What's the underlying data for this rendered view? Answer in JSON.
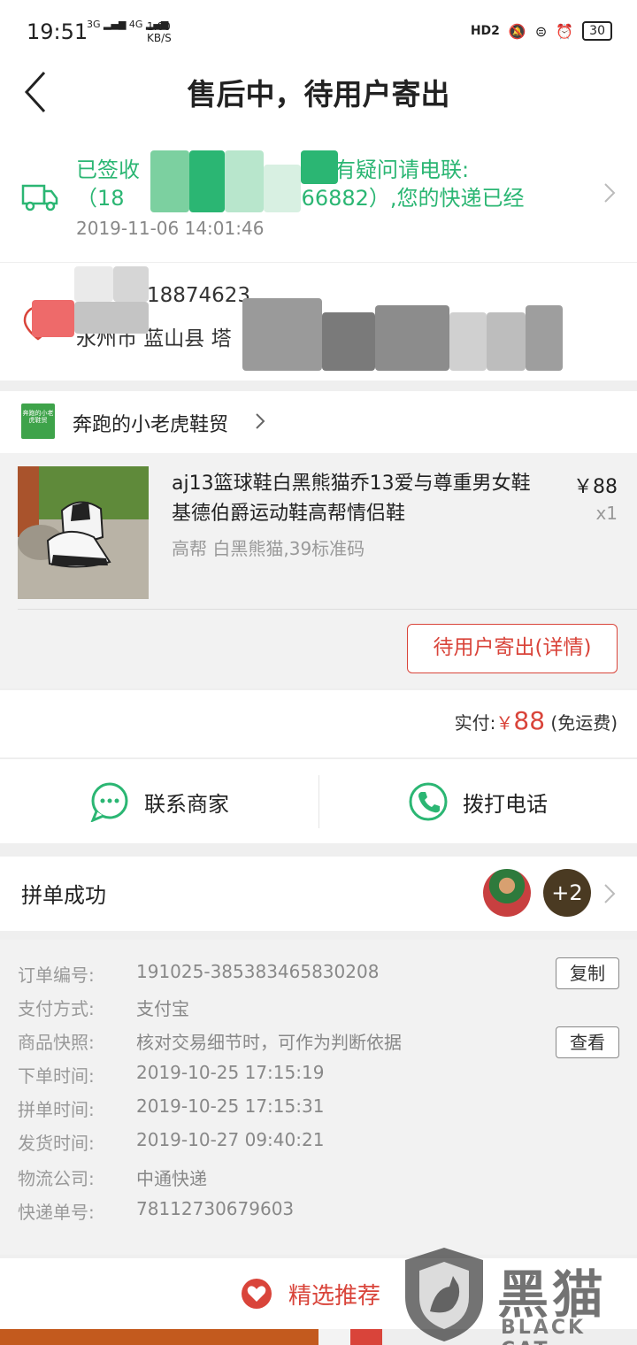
{
  "status_bar": {
    "time": "19:51",
    "net1": "3G",
    "net2": "4G",
    "speed_value": "1.00",
    "speed_unit": "KB/S",
    "hd_label": "HD2",
    "battery": "30"
  },
  "header": {
    "title": "售后中，待用户寄出"
  },
  "logistics": {
    "line1": "已签收",
    "line1_tail": "如有疑问请电联:",
    "line2_head": "（18",
    "line2_mid": "66882）,您的快递已经",
    "time": "2019-11-06 14:01:46"
  },
  "address": {
    "phone_partial": "18874623",
    "line2_head": "永州市 蓝山县 塔"
  },
  "shop": {
    "logo_text": "奔跑的小老虎鞋贸",
    "name": "奔跑的小老虎鞋贸"
  },
  "product": {
    "title": "aj13篮球鞋白黑熊猫乔13爱与尊重男女鞋基德伯爵运动鞋高帮情侣鞋",
    "price": "￥88",
    "qty": "x1",
    "spec": "高帮 白黑熊猫,39标准码",
    "status_button": "待用户寄出(详情)"
  },
  "payment": {
    "label": "实付:",
    "currency": "￥",
    "amount": "88",
    "note": "(免运费)"
  },
  "contact": {
    "merchant": "联系商家",
    "phone": "拨打电话"
  },
  "group": {
    "label": "拼单成功",
    "extra": "+2"
  },
  "order_info": {
    "rows": [
      {
        "key": "订单编号:",
        "value": "191025-385383465830208"
      },
      {
        "key": "支付方式:",
        "value": "支付宝"
      },
      {
        "key": "商品快照:",
        "value": "核对交易细节时，可作为判断依据"
      },
      {
        "key": "下单时间:",
        "value": "2019-10-25 17:15:19"
      },
      {
        "key": "拼单时间:",
        "value": "2019-10-25 17:15:31"
      },
      {
        "key": "发货时间:",
        "value": "2019-10-27 09:40:21"
      },
      {
        "key": "物流公司:",
        "value": "中通快递"
      },
      {
        "key": "快递单号:",
        "value": "78112730679603"
      }
    ],
    "copy_button": "复制",
    "view_button": "查看"
  },
  "recommend": {
    "label": "精选推荐"
  },
  "watermark": {
    "text": "黑猫",
    "sub": "BLACK CAT"
  },
  "colors": {
    "accent_red": "#d9443a",
    "logistics_green": "#2bb673"
  }
}
